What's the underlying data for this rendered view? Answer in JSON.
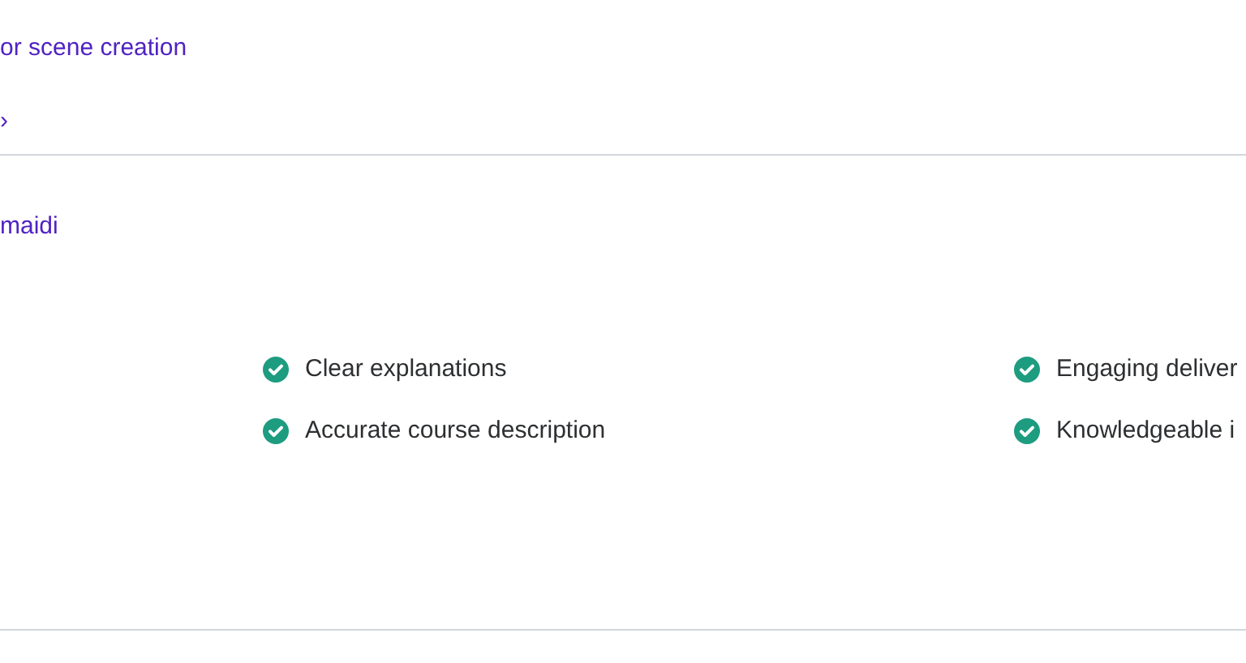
{
  "links": [
    {
      "text": "or scene creation"
    },
    {
      "text": "›"
    }
  ],
  "instructor": {
    "name": "maidi"
  },
  "highlights": [
    {
      "text": "Clear explanations",
      "checked": true
    },
    {
      "text": "Engaging deliver",
      "checked": true
    },
    {
      "text": "Accurate course description",
      "checked": true
    },
    {
      "text": "Knowledgeable i",
      "checked": true
    }
  ]
}
